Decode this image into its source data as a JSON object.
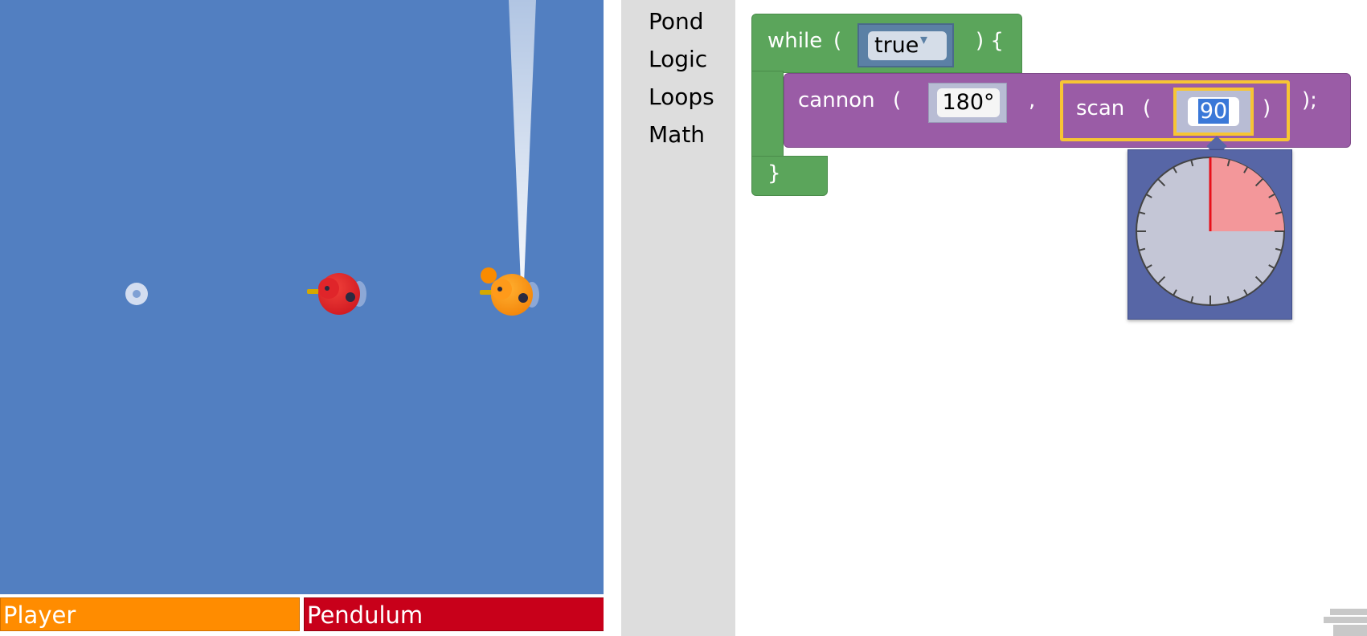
{
  "arena": {
    "players": [
      {
        "name": "Player",
        "color": "#ff8c00"
      },
      {
        "name": "Pendulum",
        "color": "#c8001a"
      }
    ]
  },
  "toolbox": {
    "categories": [
      "Pond",
      "Logic",
      "Loops",
      "Math"
    ]
  },
  "workspace": {
    "while_block": {
      "keyword": "while",
      "open": "(",
      "condition": "true",
      "dropdown_arrow": "▾",
      "close": ") {",
      "end": "}"
    },
    "cannon_block": {
      "keyword": "cannon",
      "open": "(",
      "angle": "180°",
      "separator": ",",
      "end": ");"
    },
    "scan_block": {
      "keyword": "scan",
      "open": "(",
      "value": "90",
      "close": ")"
    },
    "angle_dial": {
      "value_degrees": 90,
      "selected_color": "#f3979a",
      "needle_color": "#e8101a"
    }
  },
  "colors": {
    "water": "#527fc1",
    "logic_block": "#5ba55b",
    "pond_block": "#9a5ca6",
    "boolean_block": "#5b80a5",
    "selection": "#f7c534"
  }
}
